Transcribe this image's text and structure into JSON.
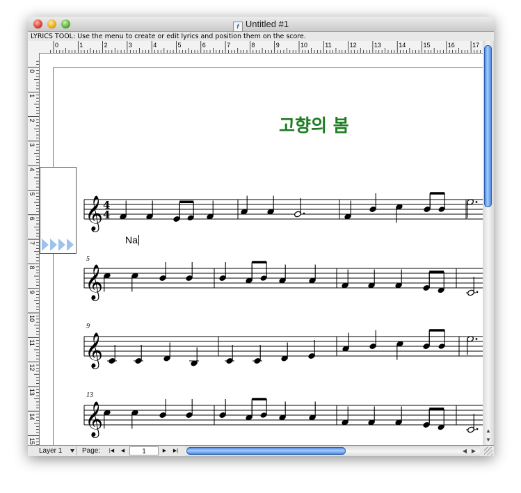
{
  "window": {
    "title": "Untitled #1"
  },
  "status": {
    "text": "LYRICS TOOL: Use the menu to create or edit lyrics and position them on the score."
  },
  "ruler": {
    "horizontal": [
      "0",
      "1",
      "2",
      "3",
      "4",
      "5",
      "6",
      "7",
      "8",
      "9",
      "10",
      "11",
      "12",
      "13",
      "14",
      "15",
      "16",
      "17"
    ],
    "vertical": [
      "0",
      "1",
      "2",
      "3",
      "4",
      "5",
      "6",
      "7",
      "8",
      "9",
      "10",
      "11",
      "12",
      "13",
      "14",
      "15"
    ]
  },
  "score": {
    "title": "고향의 봄",
    "title_color": "#1e7d23",
    "time_signature": {
      "top": "4",
      "bottom": "4"
    },
    "measure_numbers": [
      "5",
      "9",
      "13"
    ],
    "lyric_entry": "Na"
  },
  "bottom": {
    "layer_label": "Layer 1",
    "page_label": "Page:",
    "page_value": "1"
  },
  "icons": [
    "close-icon",
    "minimize-icon",
    "zoom-icon",
    "document-icon",
    "play-triangle-icon",
    "first-page-icon",
    "prev-page-icon",
    "next-page-icon",
    "last-page-icon",
    "scroll-up-icon",
    "scroll-down-icon",
    "scroll-left-icon",
    "scroll-right-icon",
    "resize-grip-icon"
  ]
}
